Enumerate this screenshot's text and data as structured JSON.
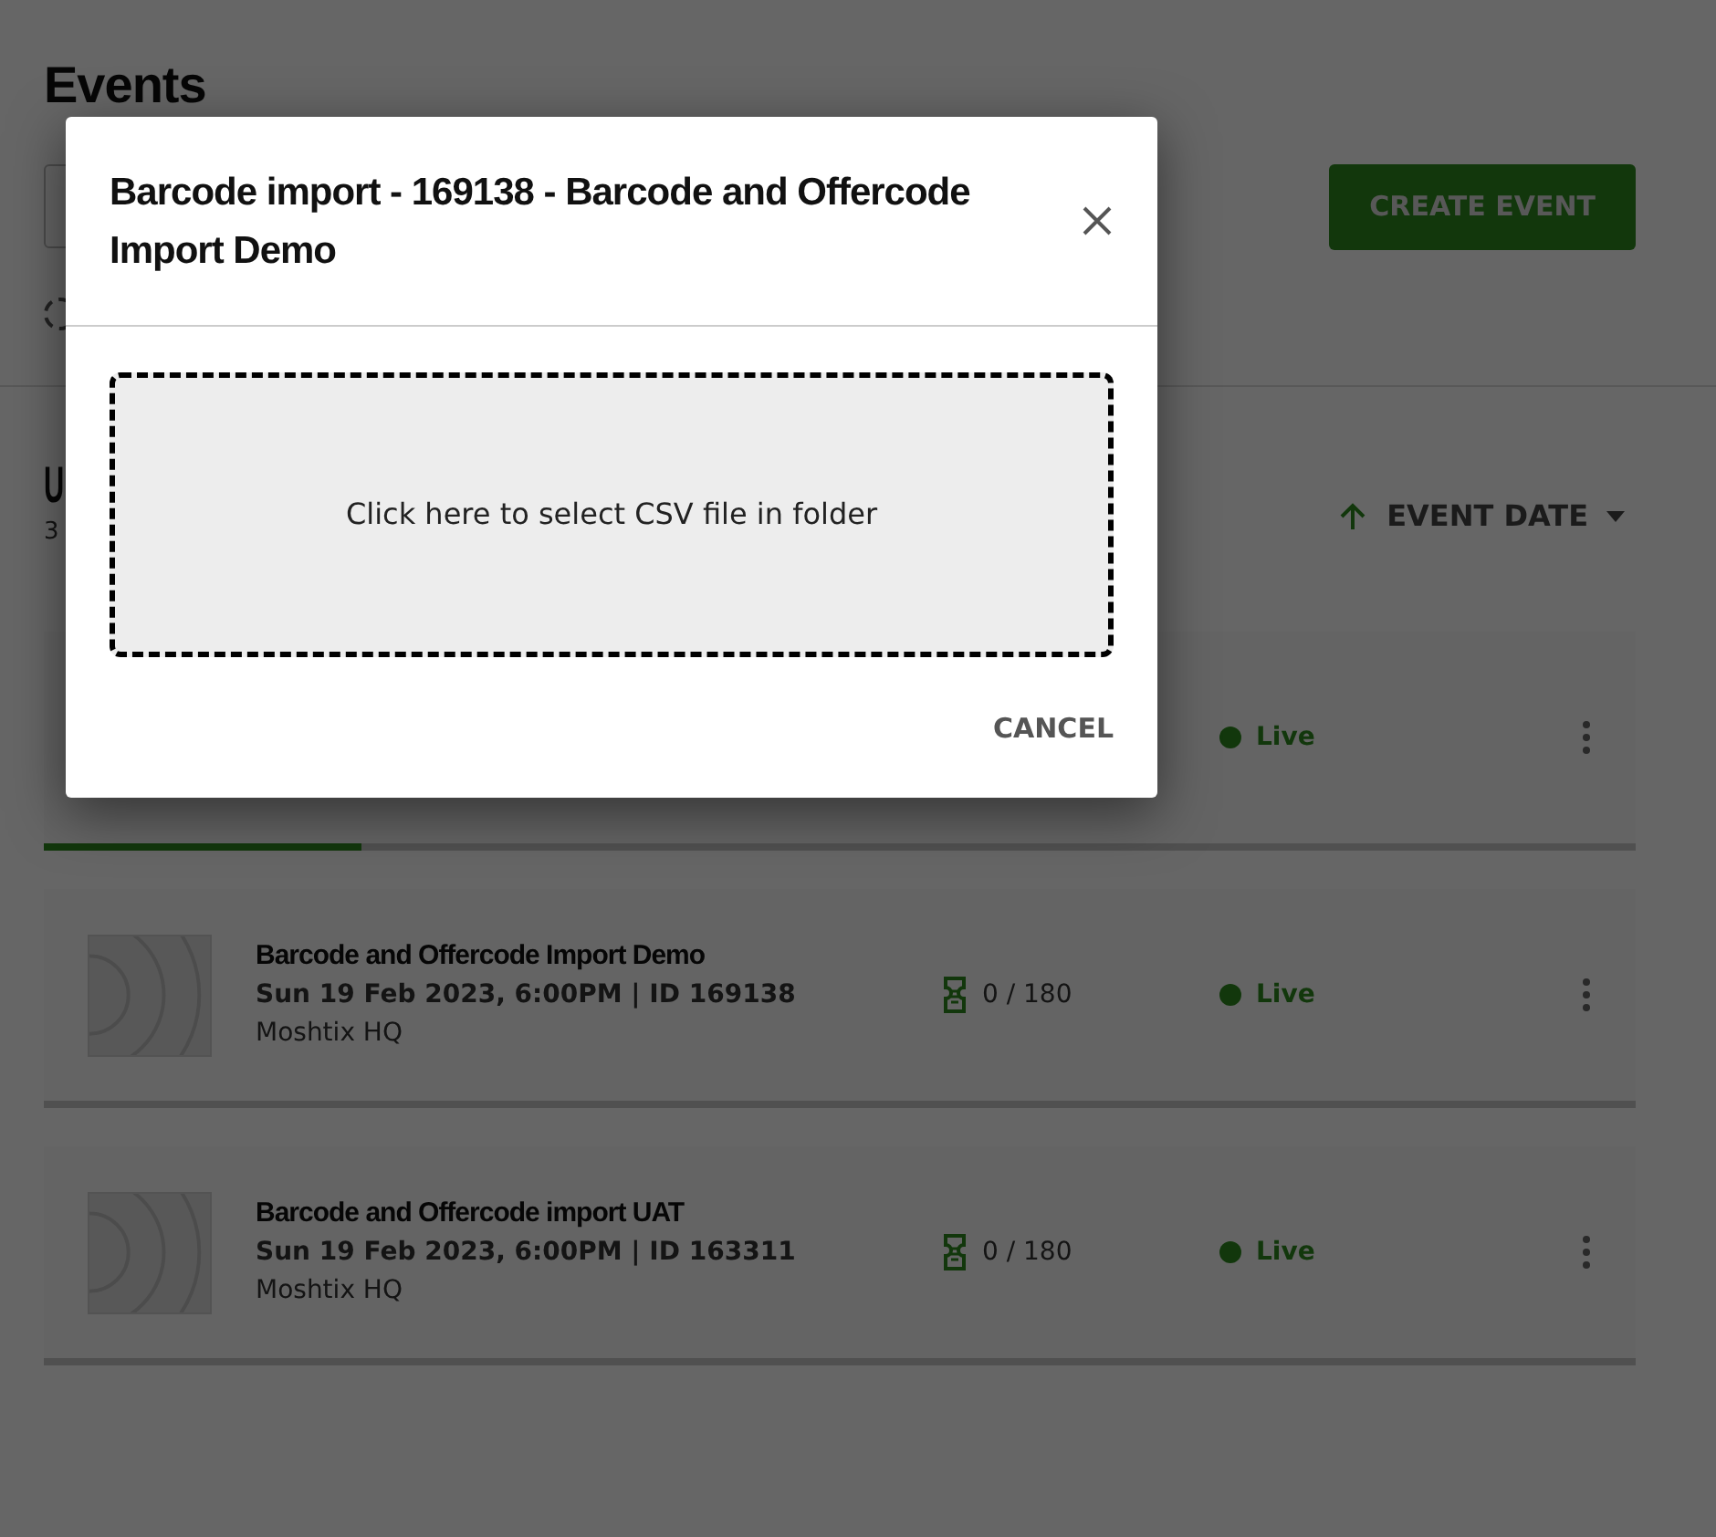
{
  "page": {
    "title": "Events",
    "create_button": "CREATE EVENT",
    "section_heading": "U",
    "event_count": "3",
    "sort": {
      "label": "EVENT DATE"
    }
  },
  "events": [
    {
      "status": "Live",
      "level": 0.2
    },
    {
      "title": "Barcode and Offercode Import Demo",
      "date_id": "Sun 19 Feb 2023, 6:00PM | ID 169138",
      "venue": "Moshtix HQ",
      "tickets": "0 / 180",
      "status": "Live"
    },
    {
      "title": "Barcode and Offercode import UAT",
      "date_id": "Sun 19 Feb 2023, 6:00PM | ID 163311",
      "venue": "Moshtix HQ",
      "tickets": "0 / 180",
      "status": "Live"
    }
  ],
  "modal": {
    "title": "Barcode import - 169138 - Barcode and Offercode Import Demo",
    "dropzone": "Click here to select CSV file in folder",
    "cancel": "CANCEL"
  }
}
